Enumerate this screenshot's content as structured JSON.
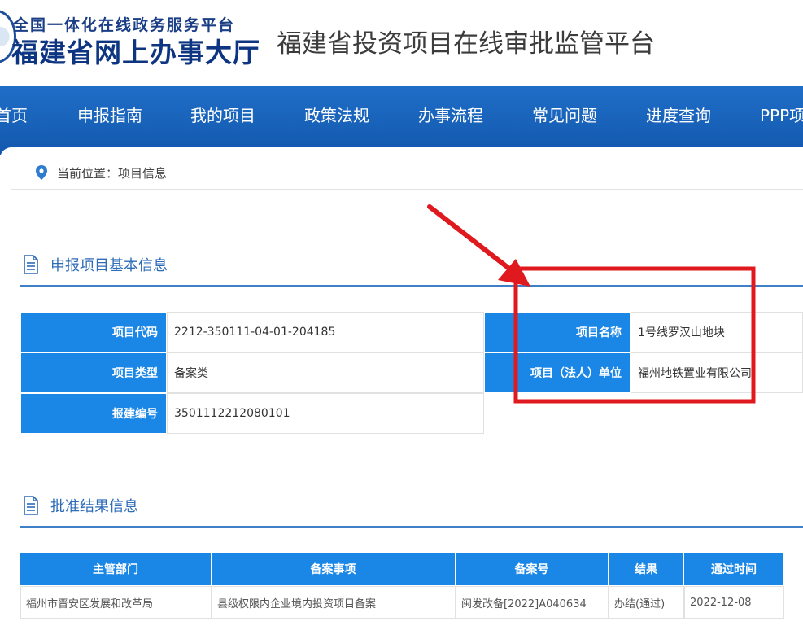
{
  "header": {
    "logo_top": "全国一体化在线政务服务平台",
    "logo_main": "福建省网上办事大厅",
    "platform_title": "福建省投资项目在线审批监管平台"
  },
  "nav": {
    "items": [
      {
        "label": "首页"
      },
      {
        "label": "申报指南"
      },
      {
        "label": "我的项目"
      },
      {
        "label": "政策法规"
      },
      {
        "label": "办事流程"
      },
      {
        "label": "常见问题"
      },
      {
        "label": "进度查询"
      },
      {
        "label": "PPP项"
      }
    ]
  },
  "breadcrumb": {
    "text": "当前位置：项目信息"
  },
  "basic_info": {
    "title": "申报项目基本信息",
    "rows": [
      {
        "label": "项目代码",
        "value": "2212-350111-04-01-204185"
      },
      {
        "label": "项目类型",
        "value": "备案类"
      },
      {
        "label": "报建编号",
        "value": "3501112212080101"
      },
      {
        "label": "项目名称",
        "value": "1号线罗汉山地块"
      },
      {
        "label": "项目（法人）单位",
        "value": "福州地铁置业有限公司"
      }
    ]
  },
  "approval": {
    "title": "批准结果信息",
    "headers": [
      "主管部门",
      "备案事项",
      "备案号",
      "结果",
      "通过时间"
    ],
    "rows": [
      [
        "福州市晋安区发展和改革局",
        "县级权限内企业境内投资项目备案",
        "闽发改备[2022]A040634",
        "办结(通过)",
        "2022-12-08"
      ]
    ]
  },
  "colors": {
    "nav_blue": "#1358ae",
    "label_blue": "#1a86e6",
    "section_blue": "#2e6cb8",
    "annotation_red": "#e0191e"
  },
  "icons": {
    "breadcrumb": "location-pin-icon",
    "section": "document-icon"
  }
}
